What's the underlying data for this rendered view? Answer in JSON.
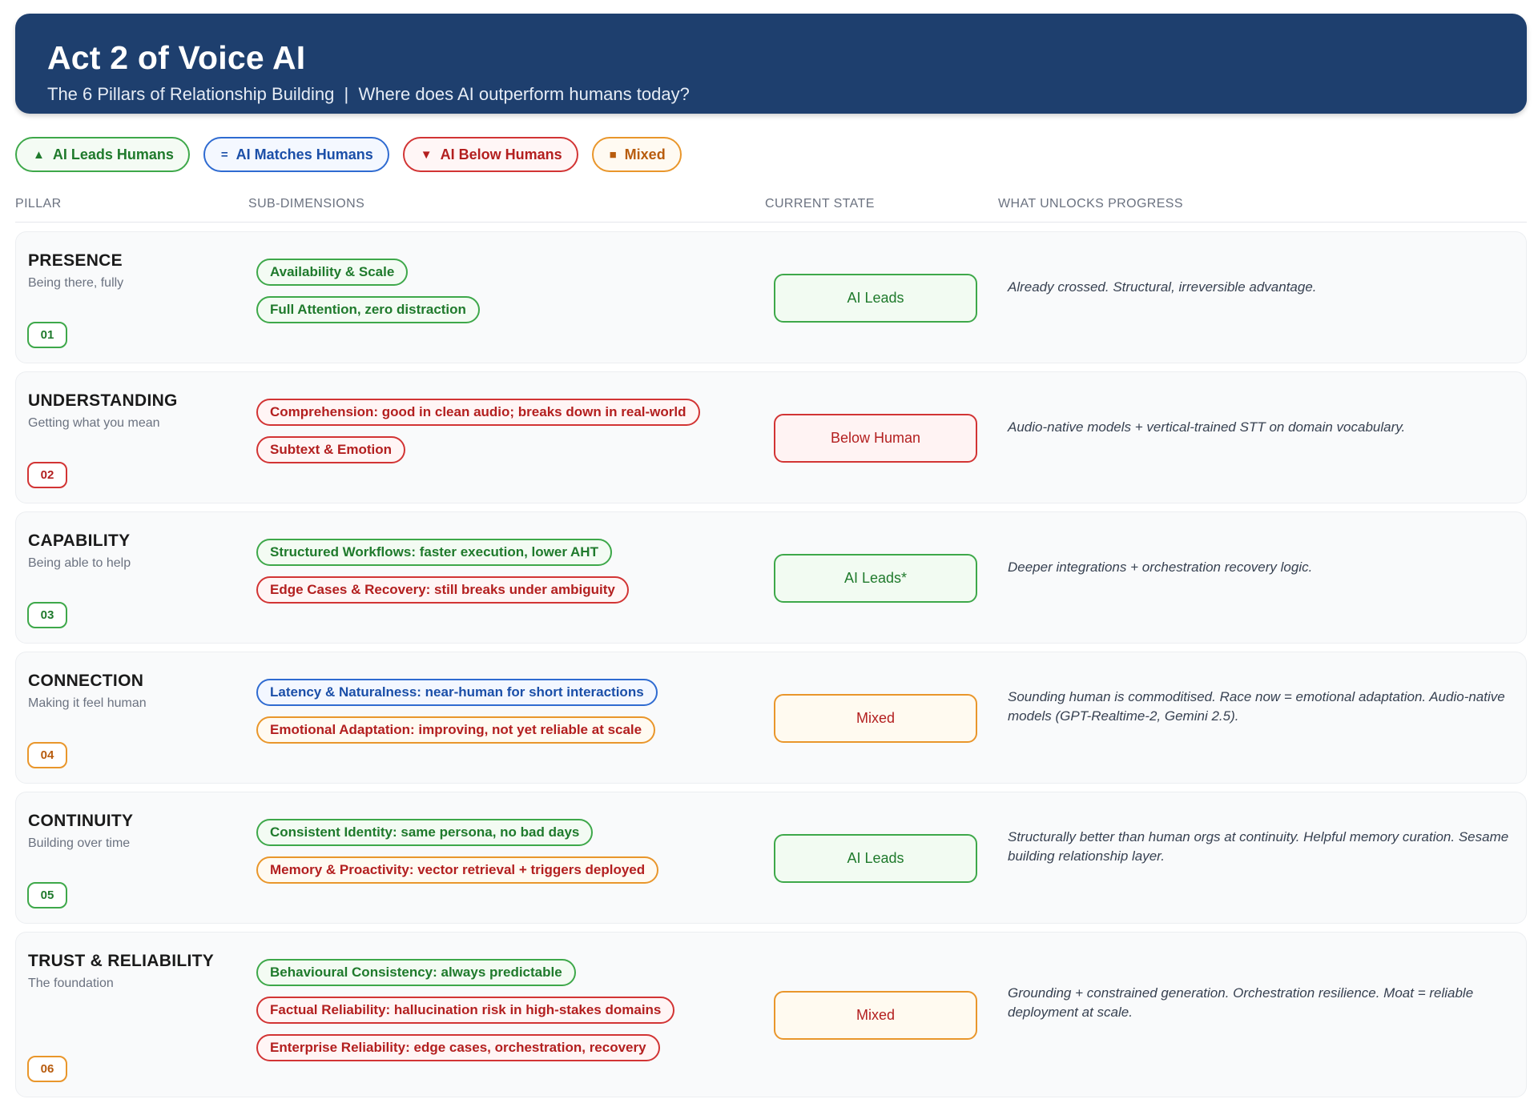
{
  "header": {
    "title": "Act 2 of Voice AI",
    "subtitle": "The 6 Pillars of Relationship Building  |  Where does AI outperform humans today?"
  },
  "legend": [
    {
      "symbol": "▲",
      "label": "AI Leads Humans",
      "color": "#1f7a2c"
    },
    {
      "symbol": "=",
      "label": "AI Matches Humans",
      "color": "#1b4fa8"
    },
    {
      "symbol": "▼",
      "label": "AI Below Humans",
      "color": "#b31f1f"
    },
    {
      "symbol": "■",
      "label": "Mixed",
      "color": "#b85c0e"
    }
  ],
  "columns": {
    "pillar": "PILLAR",
    "sub_dimensions": "SUB-DIMENSIONS",
    "current_state": "CURRENT STATE",
    "what_unlocks": "WHAT UNLOCKS PROGRESS"
  },
  "pillars": [
    {
      "name": "PRESENCE",
      "tagline": "Being there, fully",
      "number": "01",
      "number_color": "green",
      "subs": [
        {
          "label": "Availability & Scale",
          "status": "green"
        },
        {
          "label": "Full Attention, zero distraction",
          "status": "green"
        }
      ],
      "state": "AI Leads",
      "state_color": "green",
      "unlock": "Already crossed. Structural, irreversible advantage."
    },
    {
      "name": "UNDERSTANDING",
      "tagline": "Getting what you mean",
      "number": "02",
      "number_color": "red",
      "subs": [
        {
          "label": "Comprehension: good in clean audio; breaks down in real-world",
          "status": "red"
        },
        {
          "label": "Subtext & Emotion",
          "status": "red"
        }
      ],
      "state": "Below Human",
      "state_color": "red",
      "unlock": "Audio-native models + vertical-trained STT on domain vocabulary."
    },
    {
      "name": "CAPABILITY",
      "tagline": "Being able to help",
      "number": "03",
      "number_color": "green",
      "subs": [
        {
          "label": "Structured Workflows: faster execution, lower AHT",
          "status": "green"
        },
        {
          "label": "Edge Cases & Recovery: still breaks under ambiguity",
          "status": "red"
        }
      ],
      "state": "AI Leads*",
      "state_color": "green",
      "unlock": "Deeper integrations + orchestration recovery logic."
    },
    {
      "name": "CONNECTION",
      "tagline": "Making it feel human",
      "number": "04",
      "number_color": "orange",
      "subs": [
        {
          "label": "Latency & Naturalness: near-human for short interactions",
          "status": "blue"
        },
        {
          "label": "Emotional Adaptation: improving, not yet reliable at scale",
          "status": "orange"
        }
      ],
      "state": "Mixed",
      "state_color": "orange",
      "unlock": "Sounding human is commoditised. Race now = emotional adaptation. Audio-native models (GPT-Realtime-2, Gemini 2.5)."
    },
    {
      "name": "CONTINUITY",
      "tagline": "Building over time",
      "number": "05",
      "number_color": "green",
      "subs": [
        {
          "label": "Consistent Identity: same persona, no bad days",
          "status": "green"
        },
        {
          "label": "Memory & Proactivity: vector retrieval + triggers deployed",
          "status": "orange"
        }
      ],
      "state": "AI Leads",
      "state_color": "green",
      "unlock": "Structurally better than human orgs at continuity. Helpful memory curation. Sesame building relationship layer."
    },
    {
      "name": "TRUST & RELIABILITY",
      "tagline": "The foundation",
      "number": "06",
      "number_color": "orange",
      "subs": [
        {
          "label": "Behavioural Consistency: always predictable",
          "status": "green"
        },
        {
          "label": "Factual Reliability: hallucination risk in high-stakes domains",
          "status": "red"
        },
        {
          "label": "Enterprise Reliability: edge cases, orchestration, recovery",
          "status": "red"
        }
      ],
      "state": "Mixed",
      "state_color": "orange",
      "unlock": "Grounding + constrained generation. Orchestration resilience. Moat = reliable deployment at scale."
    }
  ]
}
